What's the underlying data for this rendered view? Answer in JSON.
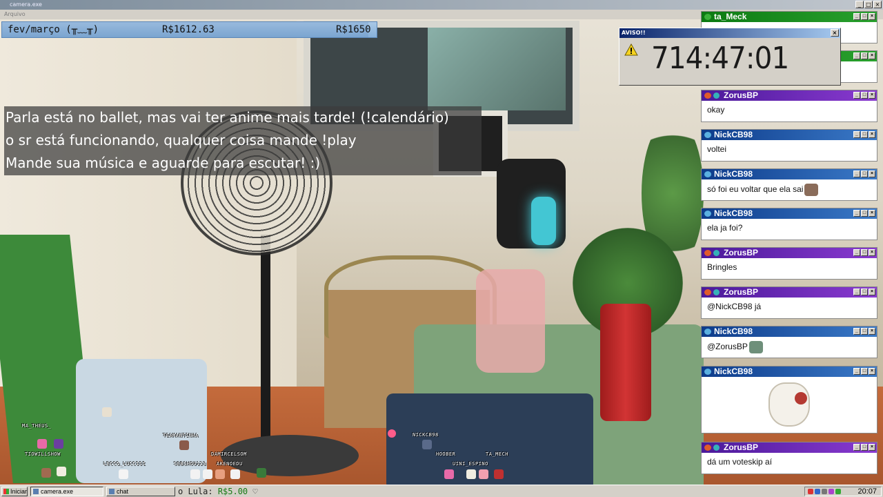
{
  "window": {
    "title": "camera.exe",
    "menu": "Arquivo"
  },
  "goal": {
    "period": "fev/março (╥﹏╥)",
    "current": "R$1612.63",
    "target": "R$1650",
    "progress_fraction": 0.977
  },
  "info_lines": [
    "Parla está no ballet, mas vai ter anime mais tarde! (!calendário)",
    "o sr está funcionando, qualquer coisa mande !play",
    "Mande sua música e aguarde para escutar! :)"
  ],
  "alert": {
    "title": "AVISO!!",
    "icon": "warning-icon",
    "timer": "714:47:01"
  },
  "chat": [
    {
      "user": "ta_Meck",
      "color": "#0b7a12",
      "text": ""
    },
    {
      "user": "",
      "color": "#0b7a12",
      "text": ""
    },
    {
      "user": "ZorusBP",
      "color": "#6a2ab6",
      "text": "okay"
    },
    {
      "user": "NickCB98",
      "color": "#0d3b8a",
      "text": "voltei"
    },
    {
      "user": "NickCB98",
      "color": "#0d3b8a",
      "text": "só foi eu voltar que ela sai"
    },
    {
      "user": "NickCB98",
      "color": "#0d3b8a",
      "text": "ela ja foi?"
    },
    {
      "user": "ZorusBP",
      "color": "#6a2ab6",
      "text": "Bringles"
    },
    {
      "user": "ZorusBP",
      "color": "#6a2ab6",
      "text": "@NickCB98 já"
    },
    {
      "user": "NickCB98",
      "color": "#0d3b8a",
      "text": "@ZorusBP"
    },
    {
      "user": "NickCB98",
      "color": "#0d3b8a",
      "text": ""
    },
    {
      "user": "ZorusBP",
      "color": "#6a2ab6",
      "text": "dá um voteskip aí"
    }
  ],
  "viewers": [
    "MA_THEUS_",
    "TIOWILLSHOW",
    "LECCO_LUCCIII",
    "TEAMANTINHA",
    "SEBSHOU123",
    "DAMIRCELSOM",
    "AKENOEDU",
    "NICKCB98",
    "HOOBER",
    "UINI_ESPINO",
    "TA_MECH"
  ],
  "taskbar": {
    "start": "Iniciar",
    "tasks": [
      "camera.exe",
      "chat"
    ],
    "donation_label": "o Lula:",
    "donation_amount": "R$5.00",
    "donation_suffix": "♡",
    "clock": "20:07"
  }
}
